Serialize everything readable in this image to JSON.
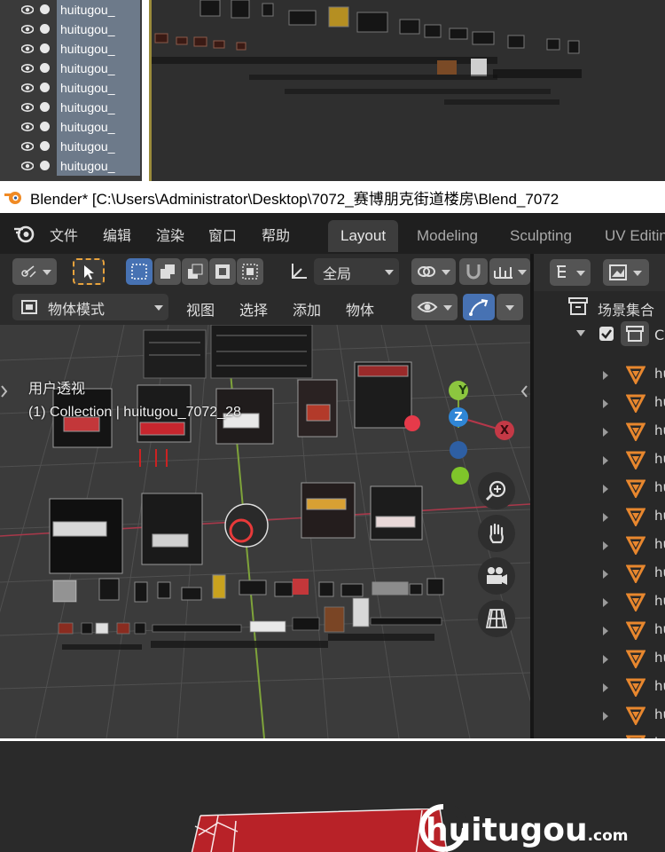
{
  "top_outliner": {
    "item_label": "huitugou_",
    "row_count": 9
  },
  "titlebar": {
    "text": "Blender* [C:\\Users\\Administrator\\Desktop\\7072_赛博朋克街道楼房\\Blend_7072"
  },
  "menu": {
    "file": "文件",
    "edit": "编辑",
    "render": "渲染",
    "window": "窗口",
    "help": "帮助"
  },
  "workspaces": [
    "Layout",
    "Modeling",
    "Sculpting",
    "UV Editing"
  ],
  "viewport_header": {
    "transform_orientation": "全局",
    "mode": "物体模式",
    "view": "视图",
    "select": "选择",
    "add": "添加",
    "object": "物体"
  },
  "viewport": {
    "perspective_label": "用户透视",
    "collection_label": "(1) Collection | huitugou_7072_28"
  },
  "gizmo": {
    "x": "X",
    "y": "Y",
    "z": "Z"
  },
  "outliner": {
    "scene_collection": "场景集合",
    "collection_initial": "C",
    "item_initial": "hu",
    "colors": {
      "mesh_icon": "#e8872e"
    }
  },
  "brand": {
    "name": "huitugou",
    "suffix": ".com"
  },
  "colors": {
    "accent_blue": "#4772b3",
    "axis_x": "#e0434b",
    "axis_y": "#8cc63f",
    "axis_z": "#2f86d6"
  }
}
